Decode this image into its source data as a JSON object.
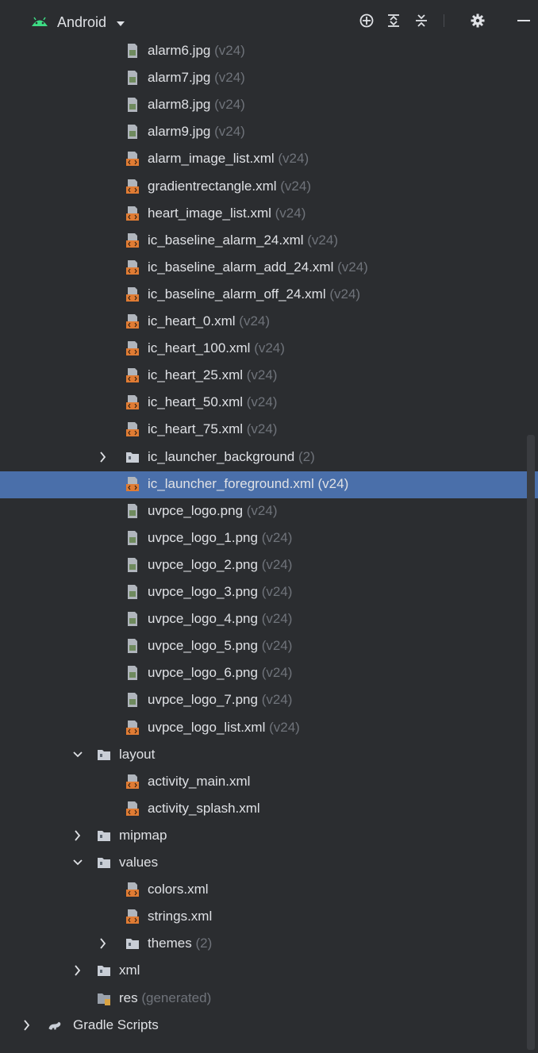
{
  "toolbar": {
    "view_label": "Android",
    "buttons": [
      "locate-icon",
      "expand-all-icon",
      "collapse-all-icon",
      "settings-icon",
      "hide-icon"
    ]
  },
  "colors": {
    "background": "#2b2d30",
    "selection": "#4a6faa",
    "text": "#dfe1e5",
    "hint": "#6f737a",
    "xml_icon": "#e07c34",
    "image_icon": "#6f8a5e",
    "folder_icon": "#c9ced6",
    "android_green": "#3ddc84"
  },
  "rows": [
    {
      "indent": 3,
      "icon": "image-file-icon",
      "name": "alarm6.jpg",
      "hint": " (v24)"
    },
    {
      "indent": 3,
      "icon": "image-file-icon",
      "name": "alarm7.jpg",
      "hint": " (v24)"
    },
    {
      "indent": 3,
      "icon": "image-file-icon",
      "name": "alarm8.jpg",
      "hint": " (v24)"
    },
    {
      "indent": 3,
      "icon": "image-file-icon",
      "name": "alarm9.jpg",
      "hint": " (v24)"
    },
    {
      "indent": 3,
      "icon": "xml-file-icon",
      "name": "alarm_image_list.xml",
      "hint": " (v24)"
    },
    {
      "indent": 3,
      "icon": "xml-file-icon",
      "name": "gradientrectangle.xml",
      "hint": " (v24)"
    },
    {
      "indent": 3,
      "icon": "xml-file-icon",
      "name": "heart_image_list.xml",
      "hint": " (v24)"
    },
    {
      "indent": 3,
      "icon": "xml-file-icon",
      "name": "ic_baseline_alarm_24.xml",
      "hint": " (v24)"
    },
    {
      "indent": 3,
      "icon": "xml-file-icon",
      "name": "ic_baseline_alarm_add_24.xml",
      "hint": " (v24)"
    },
    {
      "indent": 3,
      "icon": "xml-file-icon",
      "name": "ic_baseline_alarm_off_24.xml",
      "hint": " (v24)"
    },
    {
      "indent": 3,
      "icon": "xml-file-icon",
      "name": "ic_heart_0.xml",
      "hint": " (v24)"
    },
    {
      "indent": 3,
      "icon": "xml-file-icon",
      "name": "ic_heart_100.xml",
      "hint": " (v24)"
    },
    {
      "indent": 3,
      "icon": "xml-file-icon",
      "name": "ic_heart_25.xml",
      "hint": " (v24)"
    },
    {
      "indent": 3,
      "icon": "xml-file-icon",
      "name": "ic_heart_50.xml",
      "hint": " (v24)"
    },
    {
      "indent": 3,
      "icon": "xml-file-icon",
      "name": "ic_heart_75.xml",
      "hint": " (v24)"
    },
    {
      "indent": 3,
      "icon": "folder-icon",
      "name": "ic_launcher_background",
      "hint": " (2)",
      "chevron": "right"
    },
    {
      "indent": 3,
      "icon": "xml-file-icon",
      "name": "ic_launcher_foreground.xml",
      "hint": " (v24)",
      "selected": true
    },
    {
      "indent": 3,
      "icon": "image-file-icon",
      "name": "uvpce_logo.png",
      "hint": " (v24)"
    },
    {
      "indent": 3,
      "icon": "image-file-icon",
      "name": "uvpce_logo_1.png",
      "hint": " (v24)"
    },
    {
      "indent": 3,
      "icon": "image-file-icon",
      "name": "uvpce_logo_2.png",
      "hint": " (v24)"
    },
    {
      "indent": 3,
      "icon": "image-file-icon",
      "name": "uvpce_logo_3.png",
      "hint": " (v24)"
    },
    {
      "indent": 3,
      "icon": "image-file-icon",
      "name": "uvpce_logo_4.png",
      "hint": " (v24)"
    },
    {
      "indent": 3,
      "icon": "image-file-icon",
      "name": "uvpce_logo_5.png",
      "hint": " (v24)"
    },
    {
      "indent": 3,
      "icon": "image-file-icon",
      "name": "uvpce_logo_6.png",
      "hint": " (v24)"
    },
    {
      "indent": 3,
      "icon": "image-file-icon",
      "name": "uvpce_logo_7.png",
      "hint": " (v24)"
    },
    {
      "indent": 3,
      "icon": "xml-file-icon",
      "name": "uvpce_logo_list.xml",
      "hint": " (v24)"
    },
    {
      "indent": 2,
      "icon": "folder-icon",
      "name": "layout",
      "hint": "",
      "chevron": "down"
    },
    {
      "indent": 3,
      "icon": "xml-file-icon",
      "name": "activity_main.xml",
      "hint": ""
    },
    {
      "indent": 3,
      "icon": "xml-file-icon",
      "name": "activity_splash.xml",
      "hint": ""
    },
    {
      "indent": 2,
      "icon": "folder-icon",
      "name": "mipmap",
      "hint": "",
      "chevron": "right"
    },
    {
      "indent": 2,
      "icon": "folder-icon",
      "name": "values",
      "hint": "",
      "chevron": "down"
    },
    {
      "indent": 3,
      "icon": "xml-file-icon",
      "name": "colors.xml",
      "hint": ""
    },
    {
      "indent": 3,
      "icon": "xml-file-icon",
      "name": "strings.xml",
      "hint": ""
    },
    {
      "indent": 3,
      "icon": "folder-icon",
      "name": "themes",
      "hint": " (2)",
      "chevron": "right"
    },
    {
      "indent": 2,
      "icon": "folder-icon",
      "name": "xml",
      "hint": "",
      "chevron": "right"
    },
    {
      "indent": 2,
      "icon": "generated-folder-icon",
      "name": "res",
      "hint": " (generated)"
    },
    {
      "indent": 0,
      "icon": "gradle-icon",
      "name": "Gradle Scripts",
      "hint": "",
      "chevron": "right"
    }
  ]
}
